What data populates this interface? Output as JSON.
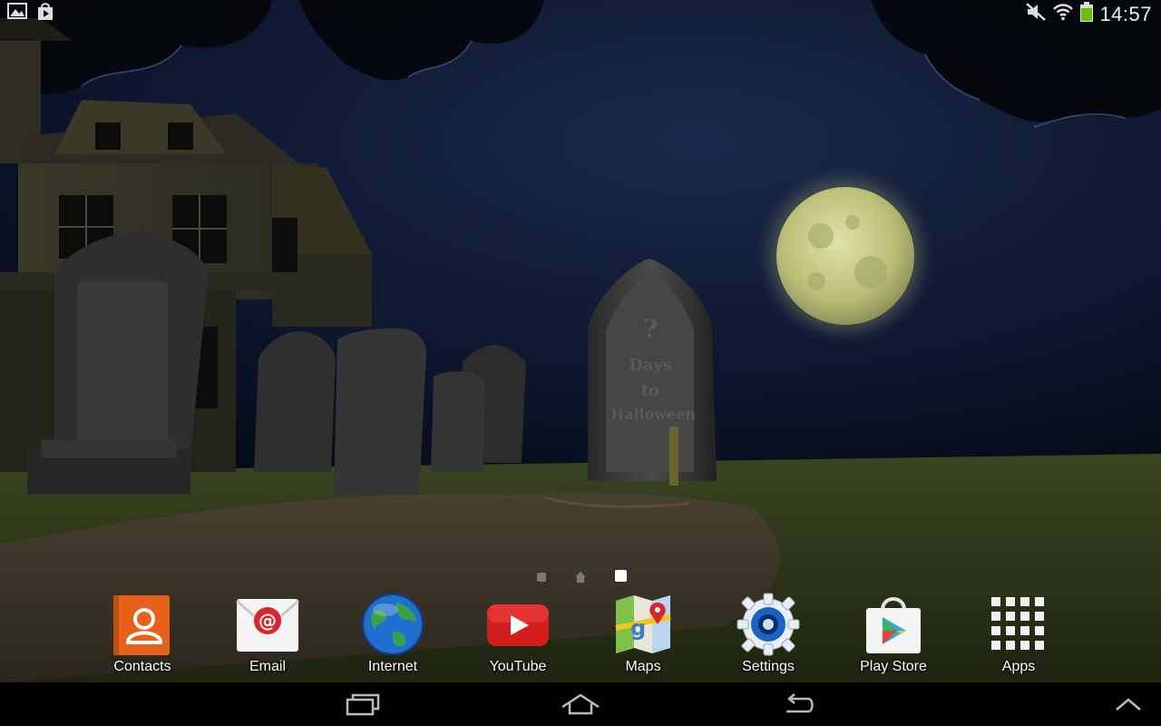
{
  "status_bar": {
    "clock": "14:57",
    "left_icons": [
      "gallery-notification-icon",
      "play-store-notification-icon"
    ],
    "right_icons": [
      "sound-muted-icon",
      "wifi-icon",
      "battery-icon"
    ]
  },
  "wallpaper": {
    "tombstone_text": [
      "?",
      "Days",
      "to",
      "Halloween"
    ]
  },
  "page_indicator": {
    "pages": 3,
    "current": 3
  },
  "dock": {
    "apps": [
      {
        "label": "Contacts",
        "icon": "contacts-icon"
      },
      {
        "label": "Email",
        "icon": "email-icon"
      },
      {
        "label": "Internet",
        "icon": "internet-globe-icon"
      },
      {
        "label": "YouTube",
        "icon": "youtube-icon"
      },
      {
        "label": "Maps",
        "icon": "maps-icon"
      },
      {
        "label": "Settings",
        "icon": "settings-gear-icon"
      },
      {
        "label": "Play Store",
        "icon": "play-store-icon"
      },
      {
        "label": "Apps",
        "icon": "apps-grid-icon"
      }
    ]
  },
  "nav_bar": {
    "buttons": [
      "recent-apps-icon",
      "home-icon",
      "back-icon",
      "menu-up-icon"
    ]
  },
  "colors": {
    "sky": "#0b1428",
    "grass": "#2c3514",
    "moon": "#c7cc8a"
  }
}
